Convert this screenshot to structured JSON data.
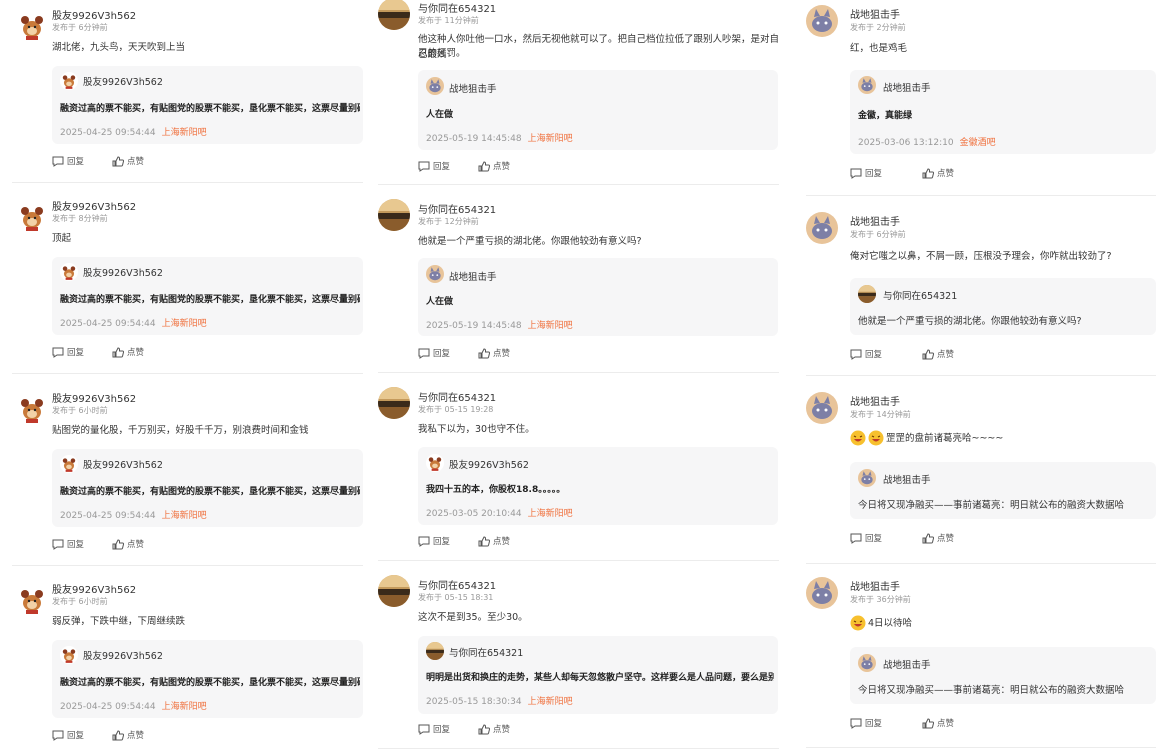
{
  "actions": {
    "reply": "回复",
    "like": "点赞"
  },
  "columns": [
    {
      "posts": [
        {
          "user": "股友9926V3h562",
          "time": "发布于 6分钟前",
          "text": "湖北佬，九头鸟，天天吹到上当",
          "quote": {
            "user": "股友9926V3h562",
            "text": "融资过高的票不能买，有贴图党的股票不能买，垦化票不能买，这票尽量别碰",
            "date": "2025-04-25 09:54:44",
            "bar": "上海新阳吧"
          }
        },
        {
          "user": "股友9926V3h562",
          "time": "发布于 8分钟前",
          "text": "顶起",
          "quote": {
            "user": "股友9926V3h562",
            "text": "融资过高的票不能买，有贴图党的股票不能买，垦化票不能买，这票尽量别碰",
            "date": "2025-04-25 09:54:44",
            "bar": "上海新阳吧"
          }
        },
        {
          "user": "股友9926V3h562",
          "time": "发布于 6小时前",
          "text": "贴图党的量化股，千万别买，好股千千万，别浪费时间和金钱",
          "quote": {
            "user": "股友9926V3h562",
            "text": "融资过高的票不能买，有贴图党的股票不能买，垦化票不能买，这票尽量别碰",
            "date": "2025-04-25 09:54:44",
            "bar": "上海新阳吧"
          }
        },
        {
          "user": "股友9926V3h562",
          "time": "发布于 6小时前",
          "text": "弱反弹，下跌中继，下周继续跌",
          "quote": {
            "user": "股友9926V3h562",
            "text": "融资过高的票不能买，有贴图党的股票不能买，垦化票不能买，这票尽量别碰",
            "date": "2025-04-25 09:54:44",
            "bar": "上海新阳吧"
          }
        }
      ]
    },
    {
      "posts": [
        {
          "user": "与你同在654321",
          "time": "发布于 11分钟前",
          "text": "他这种人你吐他一口水，然后无视他就可以了。把自己档位拉低了跟别人吵架，是对自己最残",
          "text2": "忍的惩罚。",
          "quote": {
            "user": "战地狙击手",
            "text": "人在做",
            "date": "2025-05-19 14:45:48",
            "bar": "上海新阳吧"
          }
        },
        {
          "user": "与你同在654321",
          "time": "发布于 12分钟前",
          "text": "他就是一个严重亏损的湖北佬。你跟他较劲有意义吗?",
          "quote": {
            "user": "战地狙击手",
            "text": "人在做",
            "date": "2025-05-19 14:45:48",
            "bar": "上海新阳吧"
          }
        },
        {
          "user": "与你同在654321",
          "time": "发布于 05-15 19:28",
          "text": "我私下以为，30也守不住。",
          "quote": {
            "user": "股友9926V3h562",
            "text": "我四十五的本，你股权18.8。。。。。",
            "date": "2025-03-05 20:10:44",
            "bar": "上海新阳吧"
          }
        },
        {
          "user": "与你同在654321",
          "time": "发布于 05-15 18:31",
          "text": "这次不是到35。至少30。",
          "quote": {
            "user": "与你同在654321",
            "text": "明明是出货和换庄的走势，某些人却每天忽悠散户坚守。这样要么是人品问题，要么是别有",
            "date": "2025-05-15 18:30:34",
            "bar": "上海新阳吧"
          }
        }
      ]
    },
    {
      "posts": [
        {
          "user": "战地狙击手",
          "time": "发布于 2分钟前",
          "text": "红，也是鸡毛",
          "quote": {
            "user": "战地狙击手",
            "text": "金徽，真能绿",
            "date": "2025-03-06 13:12:10",
            "bar": "金徽酒吧"
          }
        },
        {
          "user": "战地狙击手",
          "time": "发布于 6分钟前",
          "text": "俺对它嗤之以鼻，不屑一顾，压根没予理会，你咋就出较劲了?",
          "quote": {
            "user": "与你同在654321",
            "text": "他就是一个严重亏损的湖北佬。你跟他较劲有意义吗?"
          }
        },
        {
          "user": "战地狙击手",
          "time": "发布于 14分钟前",
          "text": "罡罡的盘前诸葛亮哈~~~~",
          "emojis": 2,
          "quote": {
            "user": "战地狙击手",
            "text": "今日将又现净融买——事前诸葛亮：明日就公布的融资大数据哈"
          }
        },
        {
          "user": "战地狙击手",
          "time": "发布于 36分钟前",
          "text": "4日以待哈",
          "emojis": 1,
          "quote": {
            "user": "战地狙击手",
            "text": "今日将又现净融买——事前诸葛亮：明日就公布的融资大数据哈"
          }
        }
      ]
    }
  ]
}
